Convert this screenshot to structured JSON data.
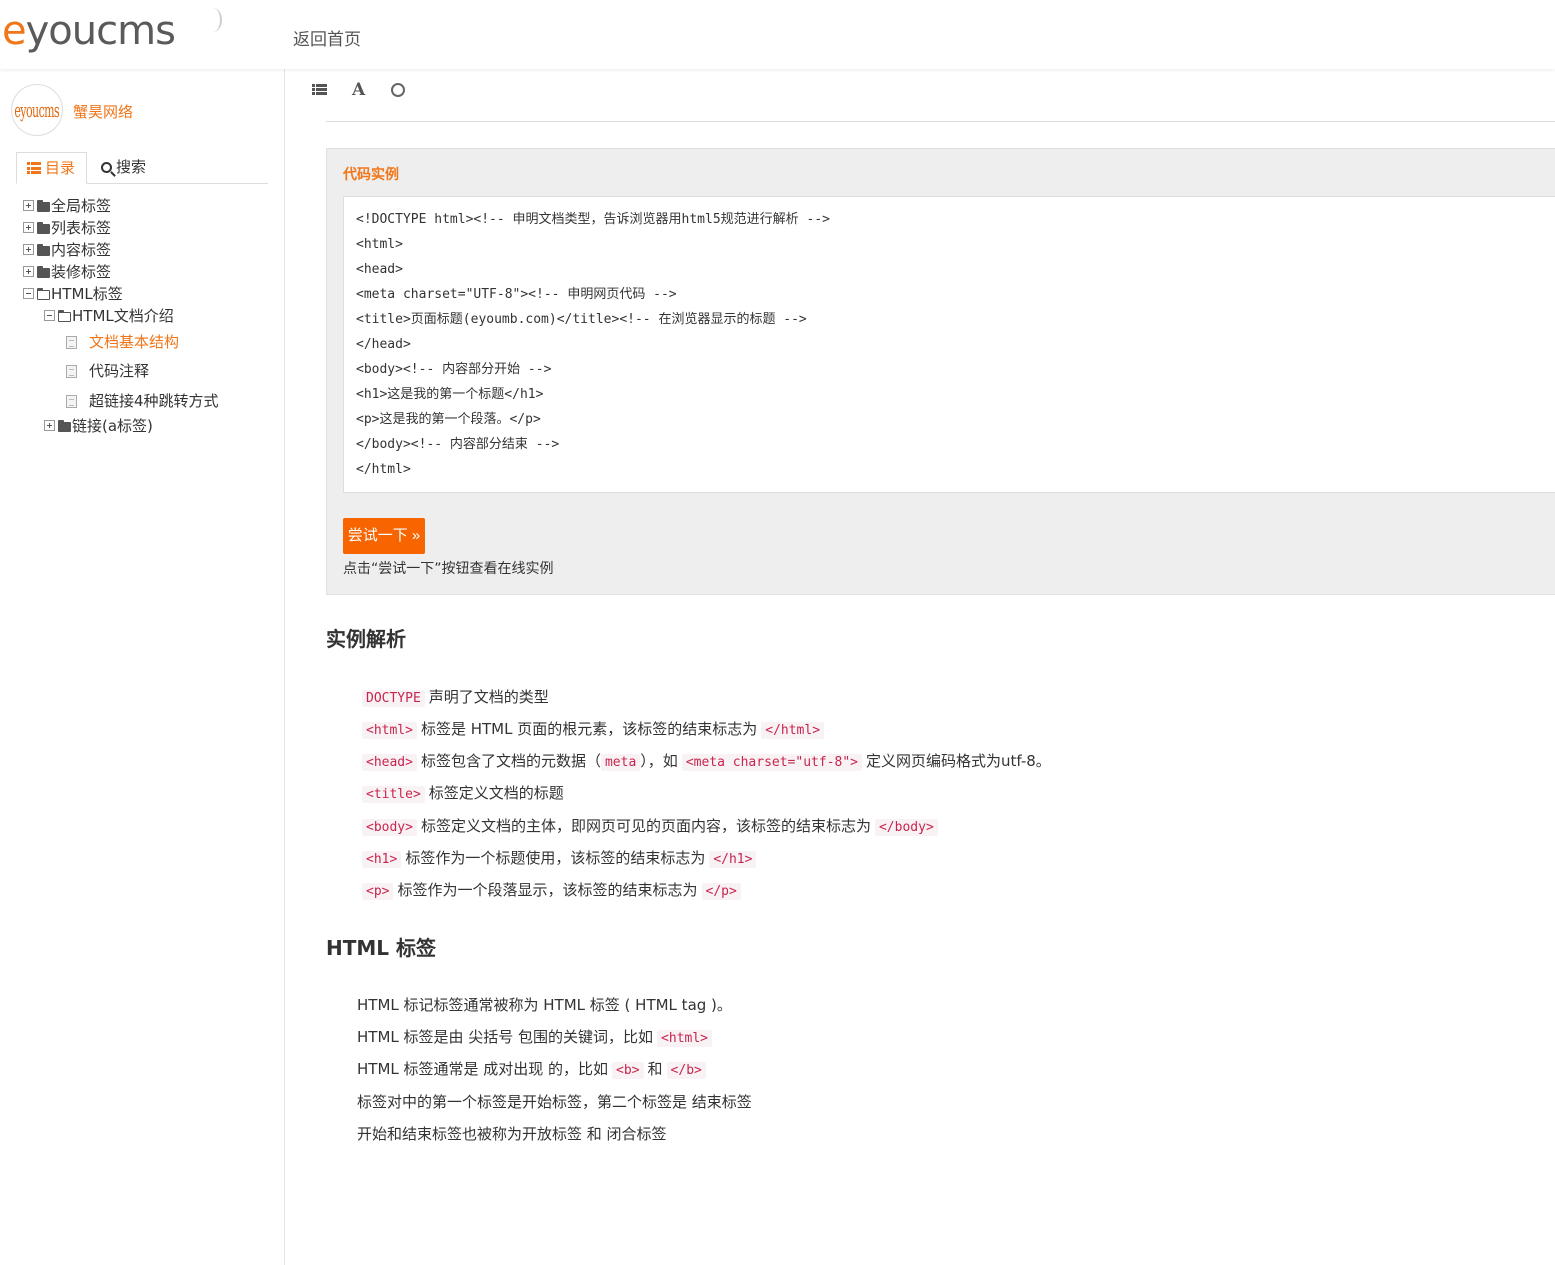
{
  "header": {
    "logo_e": "e",
    "logo_rest": "youcms",
    "home_link": "返回首页"
  },
  "sidebar": {
    "avatar_text": "eyoucms",
    "site_name": "蟹昊网络",
    "tabs": {
      "toc": "目录",
      "search": "搜索"
    },
    "tree": [
      {
        "label": "全局标签"
      },
      {
        "label": "列表标签"
      },
      {
        "label": "内容标签"
      },
      {
        "label": "装修标签"
      },
      {
        "label": "HTML标签"
      },
      {
        "label": "HTML文档介绍"
      },
      {
        "label": "文档基本结构"
      },
      {
        "label": "代码注释"
      },
      {
        "label": "超链接4种跳转方式"
      },
      {
        "label": "链接(a标签)"
      }
    ]
  },
  "toolbar": {
    "font_glyph": "A"
  },
  "example": {
    "title": "代码实例",
    "code": [
      "<!DOCTYPE html><!-- 申明文档类型，告诉浏览器用html5规范进行解析 -->",
      "<html>",
      "<head>",
      "<meta charset=\"UTF-8\"><!-- 申明网页代码 -->",
      "<title>页面标题(eyoumb.com)</title><!-- 在浏览器显示的标题 -->",
      "</head>",
      "<body><!-- 内容部分开始 -->",
      "<h1>这是我的第一个标题</h1>",
      "<p>这是我的第一个段落。</p>",
      "</body><!-- 内容部分结束 -->",
      "</html>"
    ],
    "try_button": "尝试一下 »",
    "try_tip": "点击“尝试一下”按钮查看在线实例"
  },
  "analysis": {
    "heading": "实例解析",
    "items": {
      "doctype": {
        "c1": "DOCTYPE",
        "t1": "声明了文档的类型"
      },
      "html": {
        "c1": "<html>",
        "t1": "标签是 HTML 页面的根元素，该标签的结束标志为",
        "c2": "</html>"
      },
      "head": {
        "c1": "<head>",
        "t1": "标签包含了文档的元数据（",
        "c2": "meta",
        "t2": "），如",
        "c3": "<meta charset=\"utf-8\">",
        "t3": "定义网页编码格式为utf-8。"
      },
      "title": {
        "c1": "<title>",
        "t1": "标签定义文档的标题"
      },
      "body": {
        "c1": "<body>",
        "t1": "标签定义文档的主体，即网页可见的页面内容，该标签的结束标志为",
        "c2": "</body>"
      },
      "h1": {
        "c1": "<h1>",
        "t1": "标签作为一个标题使用，该标签的结束标志为",
        "c2": "</h1>"
      },
      "p": {
        "c1": "<p>",
        "t1": "标签作为一个段落显示，该标签的结束标志为",
        "c2": "</p>"
      }
    }
  },
  "tags_section": {
    "heading": "HTML 标签",
    "line1": "HTML 标记标签通常被称为 HTML 标签 ( HTML tag )。",
    "line2_text": "HTML 标签是由 尖括号 包围的关键词，比如",
    "line2_code": "<html>",
    "line3_text": "HTML 标签通常是 成对出现 的，比如",
    "line3_code1": "<b>",
    "line3_and": "和",
    "line3_code2": "</b>",
    "line4": "标签对中的第一个标签是开始标签，第二个标签是 结束标签",
    "line5": "开始和结束标签也被称为开放标签 和 闭合标签"
  },
  "colors": {
    "accent": "#f07619",
    "button": "#f76400",
    "code_text": "#c7254e",
    "code_bg": "#f9f2f4"
  }
}
